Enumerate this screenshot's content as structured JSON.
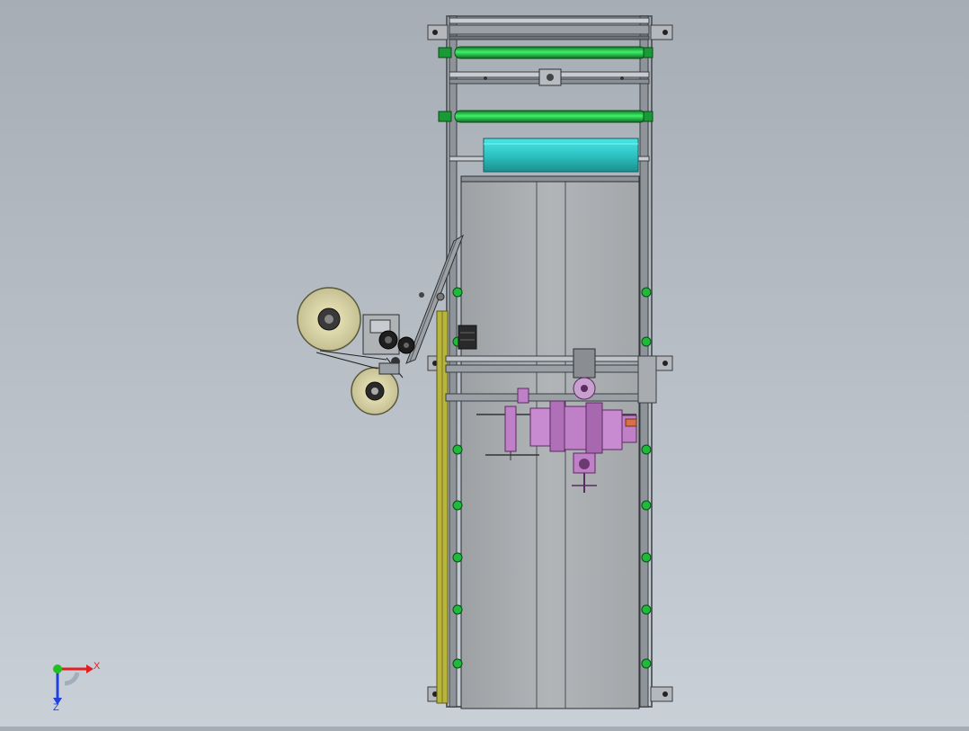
{
  "app": {
    "title": ""
  },
  "view": {
    "triad": {
      "x_label": "X",
      "z_label": "Z",
      "x_color": "#e02020",
      "y_color": "#20c020",
      "z_color": "#2040e0"
    }
  },
  "colors": {
    "background_top": "#a7adb5",
    "background_bottom": "#c9d0d7",
    "frame": "#8e949a",
    "frame_dark": "#3a3e42",
    "belt_panel": "#a9adb0",
    "roller_green": "#22cc44",
    "film_roll_cyan": "#33c9c9",
    "side_rail_yellow": "#b8b43c",
    "labeler_body": "#9a9a8a",
    "label_roll": "#d8d2a4",
    "wrap_head_purple": "#c080c8"
  },
  "model": {
    "name": "",
    "components": [
      "conveyor-frame",
      "top-roller",
      "upper-roller",
      "film-roll",
      "belt-panel",
      "side-rail",
      "label-applicator",
      "wrap-head",
      "cross-beam"
    ]
  }
}
